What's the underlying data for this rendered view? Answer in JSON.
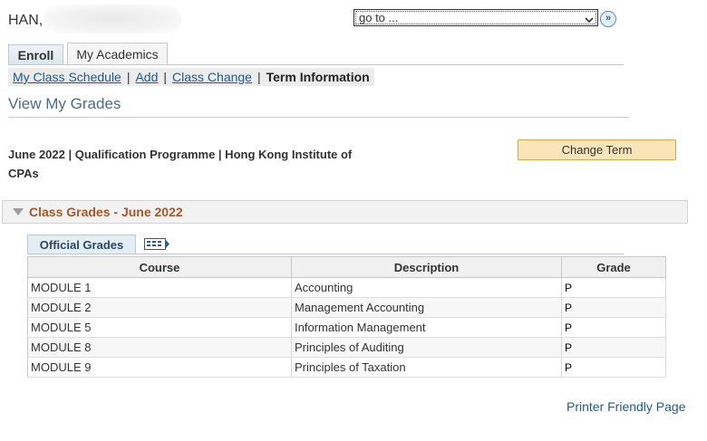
{
  "header": {
    "user_name": "HAN,"
  },
  "goto": {
    "value": "go to ...",
    "arrow": "⌄"
  },
  "go_button": {
    "icon": "double-chevron-right-icon",
    "glyph": "»"
  },
  "tabs": [
    {
      "label": "Enroll",
      "active": true
    },
    {
      "label": "My Academics",
      "active": false
    }
  ],
  "subnav": {
    "links": [
      "My Class Schedule",
      "Add",
      "Class Change"
    ],
    "separator": "|",
    "current": "Term Information"
  },
  "page_title": "View My Grades",
  "term_info": "June 2022 | Qualification Programme | Hong Kong Institute of CPAs",
  "change_term_label": "Change Term",
  "grades_section": {
    "title": "Class Grades - June 2022"
  },
  "grades_tab": {
    "label": "Official Grades",
    "grid_icon": "grid-view-icon"
  },
  "table": {
    "headers": [
      "Course",
      "Description",
      "Grade"
    ],
    "rows": [
      [
        "MODULE 1",
        "Accounting",
        "P"
      ],
      [
        "MODULE 2",
        "Management Accounting",
        "P"
      ],
      [
        "MODULE 5",
        "Information Management",
        "P"
      ],
      [
        "MODULE 8",
        "Principles of Auditing",
        "P"
      ],
      [
        "MODULE 9",
        "Principles of Taxation",
        "P"
      ]
    ]
  },
  "printer_link": "Printer Friendly Page",
  "colors": {
    "link": "#1d5a95",
    "section_title": "#a8582a",
    "button_bg": "#fbe4b7",
    "page_title": "#4a6c89"
  }
}
